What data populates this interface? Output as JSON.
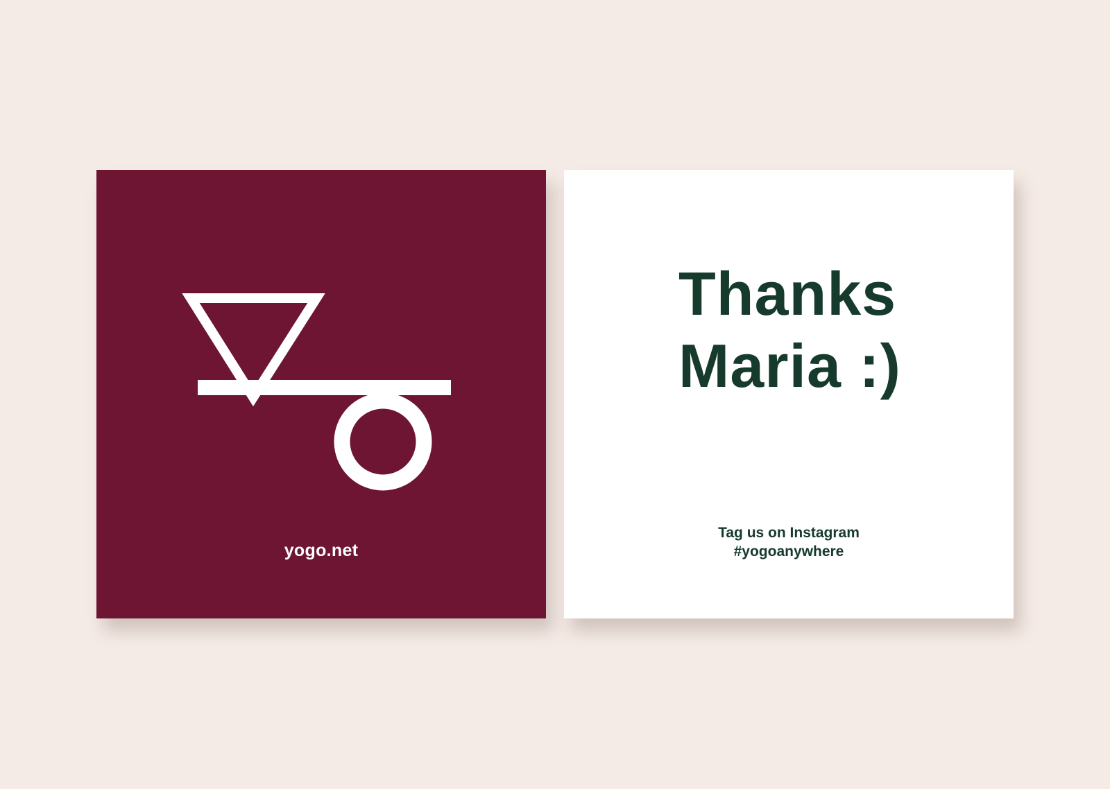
{
  "colors": {
    "background": "#f5ebe6",
    "brand_maroon": "#6d1533",
    "card_white": "#ffffff",
    "text_dark_green": "#163a2c"
  },
  "front_card": {
    "logo_icon": "yogo-logo-icon",
    "website": "yogo.net"
  },
  "back_card": {
    "message_line_1": "Thanks",
    "message_line_2": "Maria :)",
    "social_line_1": "Tag us on Instagram",
    "social_line_2": "#yogoanywhere"
  }
}
